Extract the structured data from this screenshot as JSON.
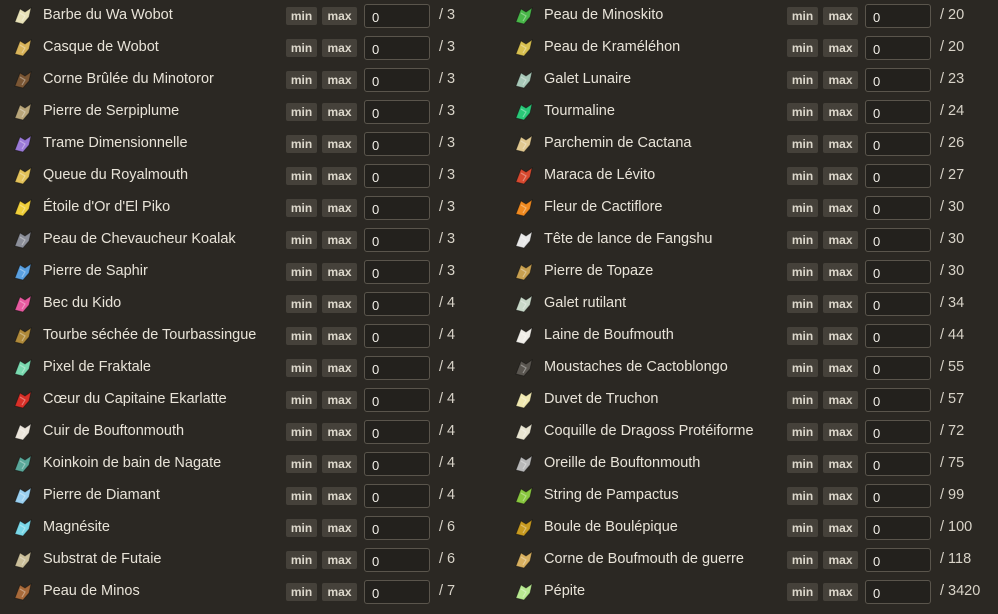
{
  "left": [
    {
      "name": "Barbe du Wa Wobot",
      "value": "0",
      "total": "/ 3",
      "icon": "feather-icon",
      "color": "#e8e2b8"
    },
    {
      "name": "Casque de Wobot",
      "value": "0",
      "total": "/ 3",
      "icon": "helmet-icon",
      "color": "#d9b45a"
    },
    {
      "name": "Corne Brûlée du Minotoror",
      "value": "0",
      "total": "/ 3",
      "icon": "horn-icon",
      "color": "#7a5634"
    },
    {
      "name": "Pierre de Serpiplume",
      "value": "0",
      "total": "/ 3",
      "icon": "stone-icon",
      "color": "#b9a67a"
    },
    {
      "name": "Trame Dimensionnelle",
      "value": "0",
      "total": "/ 3",
      "icon": "fabric-icon",
      "color": "#9b7ad8"
    },
    {
      "name": "Queue du Royalmouth",
      "value": "0",
      "total": "/ 3",
      "icon": "tail-icon",
      "color": "#e3c25a"
    },
    {
      "name": "Étoile d'Or d'El Piko",
      "value": "0",
      "total": "/ 3",
      "icon": "star-icon",
      "color": "#f0cf3a"
    },
    {
      "name": "Peau de Chevaucheur Koalak",
      "value": "0",
      "total": "/ 3",
      "icon": "hide-icon",
      "color": "#8c8f99"
    },
    {
      "name": "Pierre de Saphir",
      "value": "0",
      "total": "/ 3",
      "icon": "crystal-icon",
      "color": "#5aa0e0"
    },
    {
      "name": "Bec du Kido",
      "value": "0",
      "total": "/ 4",
      "icon": "beak-icon",
      "color": "#e85aa0"
    },
    {
      "name": "Tourbe séchée de Tourbassingue",
      "value": "0",
      "total": "/ 4",
      "icon": "peat-icon",
      "color": "#b08a3a"
    },
    {
      "name": "Pixel de Fraktale",
      "value": "0",
      "total": "/ 4",
      "icon": "pixel-icon",
      "color": "#7adab0"
    },
    {
      "name": "Cœur du Capitaine Ekarlatte",
      "value": "0",
      "total": "/ 4",
      "icon": "heart-icon",
      "color": "#d83028"
    },
    {
      "name": "Cuir de Bouftonmouth",
      "value": "0",
      "total": "/ 4",
      "icon": "leather-icon",
      "color": "#ece6dc"
    },
    {
      "name": "Koinkoin de bain de Nagate",
      "value": "0",
      "total": "/ 4",
      "icon": "duck-icon",
      "color": "#5aa89a"
    },
    {
      "name": "Pierre de Diamant",
      "value": "0",
      "total": "/ 4",
      "icon": "diamond-icon",
      "color": "#9ad0f0"
    },
    {
      "name": "Magnésite",
      "value": "0",
      "total": "/ 6",
      "icon": "bar-icon",
      "color": "#7ad8e8"
    },
    {
      "name": "Substrat de Futaie",
      "value": "0",
      "total": "/ 6",
      "icon": "substrate-icon",
      "color": "#cbbf9a"
    },
    {
      "name": "Peau de Minos",
      "value": "0",
      "total": "/ 7",
      "icon": "pelt-icon",
      "color": "#a86a3a"
    }
  ],
  "right": [
    {
      "name": "Peau de Minoskito",
      "value": "0",
      "total": "/ 20",
      "icon": "leaf-icon",
      "color": "#4ab84a"
    },
    {
      "name": "Peau de Kraméléhon",
      "value": "0",
      "total": "/ 20",
      "icon": "scroll-icon",
      "color": "#d8c050"
    },
    {
      "name": "Galet Lunaire",
      "value": "0",
      "total": "/ 23",
      "icon": "pebble-icon",
      "color": "#a8c8b8"
    },
    {
      "name": "Tourmaline",
      "value": "0",
      "total": "/ 24",
      "icon": "gem-icon",
      "color": "#2ac878"
    },
    {
      "name": "Parchemin de Cactana",
      "value": "0",
      "total": "/ 26",
      "icon": "parchment-icon",
      "color": "#e0c890"
    },
    {
      "name": "Maraca de Lévito",
      "value": "0",
      "total": "/ 27",
      "icon": "maraca-icon",
      "color": "#d84a30"
    },
    {
      "name": "Fleur de Cactiflore",
      "value": "0",
      "total": "/ 30",
      "icon": "flower-icon",
      "color": "#f08a20"
    },
    {
      "name": "Tête de lance de Fangshu",
      "value": "0",
      "total": "/ 30",
      "icon": "spearhead-icon",
      "color": "#e8e8e8"
    },
    {
      "name": "Pierre de Topaze",
      "value": "0",
      "total": "/ 30",
      "icon": "topaz-icon",
      "color": "#c8a050"
    },
    {
      "name": "Galet rutilant",
      "value": "0",
      "total": "/ 34",
      "icon": "shiny-pebble-icon",
      "color": "#c8d8c8"
    },
    {
      "name": "Laine de Boufmouth",
      "value": "0",
      "total": "/ 44",
      "icon": "wool-icon",
      "color": "#f0eee8"
    },
    {
      "name": "Moustaches de Cactoblongo",
      "value": "0",
      "total": "/ 55",
      "icon": "whiskers-icon",
      "color": "#5a5650"
    },
    {
      "name": "Duvet de Truchon",
      "value": "0",
      "total": "/ 57",
      "icon": "down-icon",
      "color": "#f0e8b0"
    },
    {
      "name": "Coquille de Dragoss Protéiforme",
      "value": "0",
      "total": "/ 72",
      "icon": "shell-icon",
      "color": "#e8e4d0"
    },
    {
      "name": "Oreille de Bouftonmouth",
      "value": "0",
      "total": "/ 75",
      "icon": "ear-icon",
      "color": "#b8b8b8"
    },
    {
      "name": "String de Pampactus",
      "value": "0",
      "total": "/ 99",
      "icon": "string-icon",
      "color": "#8ac840"
    },
    {
      "name": "Boule de Boulépique",
      "value": "0",
      "total": "/ 100",
      "icon": "spiky-ball-icon",
      "color": "#c89a20"
    },
    {
      "name": "Corne de Boufmouth de guerre",
      "value": "0",
      "total": "/ 118",
      "icon": "war-horn-icon",
      "color": "#d8b060"
    },
    {
      "name": "Pépite",
      "value": "0",
      "total": "/ 3420",
      "icon": "nugget-icon",
      "color": "#b8e890"
    }
  ],
  "buttons": {
    "min_label": "min",
    "max_label": "max"
  }
}
